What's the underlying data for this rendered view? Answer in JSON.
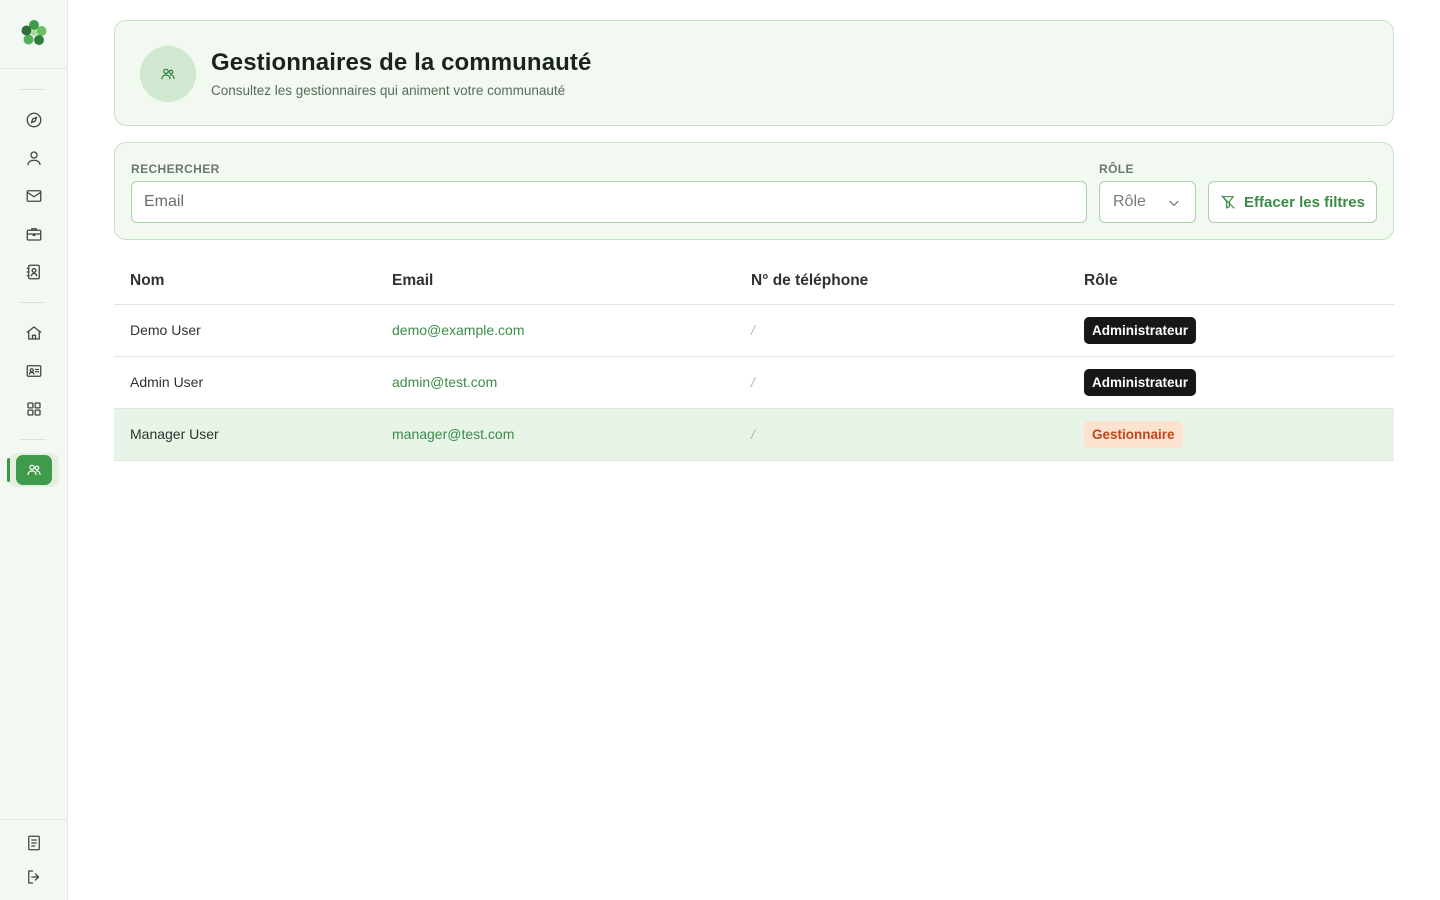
{
  "sidebar": {
    "items": [
      {
        "name": "compass-icon"
      },
      {
        "name": "user-icon"
      },
      {
        "name": "mail-icon"
      },
      {
        "name": "briefcase-icon"
      },
      {
        "name": "contact-book-icon"
      },
      {
        "name": "home-icon"
      },
      {
        "name": "id-card-icon"
      },
      {
        "name": "grid-icon"
      },
      {
        "name": "community-managers-icon",
        "active": true
      }
    ],
    "bottom": [
      {
        "name": "document-icon"
      },
      {
        "name": "logout-icon"
      }
    ]
  },
  "header": {
    "title": "Gestionnaires de la communauté",
    "subtitle": "Consultez les gestionnaires qui animent votre communauté"
  },
  "filters": {
    "search_label": "RECHERCHER",
    "search_placeholder": "Email",
    "search_value": "",
    "role_label": "RÔLE",
    "role_placeholder": "Rôle",
    "clear_label": "Effacer les filtres"
  },
  "table": {
    "columns": [
      "Nom",
      "Email",
      "N° de téléphone",
      "Rôle"
    ],
    "rows": [
      {
        "name": "Demo User",
        "email": "demo@example.com",
        "phone": "/",
        "role": "Administrateur",
        "role_type": "admin"
      },
      {
        "name": "Admin User",
        "email": "admin@test.com",
        "phone": "/",
        "role": "Administrateur",
        "role_type": "admin"
      },
      {
        "name": "Manager User",
        "email": "manager@test.com",
        "phone": "/",
        "role": "Gestionnaire",
        "role_type": "manager"
      }
    ]
  },
  "colors": {
    "accent": "#3f9b4c",
    "card_background": "#f2f9f1",
    "admin_badge": "#161716",
    "manager_badge": "#fde3cf"
  }
}
